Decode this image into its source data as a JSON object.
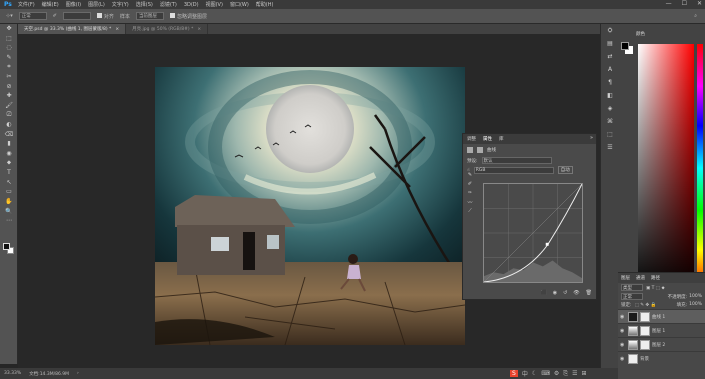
{
  "app": {
    "logo": "Ps"
  },
  "menubar": {
    "items": [
      "文件(F)",
      "编辑(E)",
      "图像(I)",
      "图层(L)",
      "文字(Y)",
      "选择(S)",
      "滤镜(T)",
      "3D(D)",
      "视图(V)",
      "窗口(W)",
      "帮助(H)"
    ],
    "window_controls": [
      "—",
      "☐",
      "✕"
    ]
  },
  "options_bar": {
    "mode": "正常",
    "checkbox_label": "对齐",
    "sample_label": "样本",
    "sample_value": "当前图层",
    "ignore_label": "忽略调整图层"
  },
  "tabs": [
    {
      "label": "天空.psd @ 33.3% (曲线 1, 图层蒙版/8) *",
      "active": true
    },
    {
      "label": "月亮.jpg @ 50% (RGB/8#) *",
      "active": false
    }
  ],
  "tools": [
    "✥",
    "⬚",
    "◌",
    "✎",
    "⌗",
    "✂",
    "⊘",
    "✚",
    "🖌",
    "⎚",
    "◐",
    "⌫",
    "▮",
    "◉",
    "⬥",
    "T",
    "↖",
    "▭",
    "✋",
    "🔍",
    "⋯"
  ],
  "status": {
    "zoom": "33.33%",
    "doc": "文档:14.3M/86.9M",
    "arrow": "›"
  },
  "taskbar": [
    "S",
    "中",
    "☾",
    "⌨",
    "⚙",
    "⎘",
    "☰",
    "⊞"
  ],
  "right_strip": [
    "⛭",
    "▤",
    "⇄",
    "A",
    "¶",
    "◧",
    "◈",
    "⌘",
    "⬚",
    "☰"
  ],
  "color_panel": {
    "tab": "颜色"
  },
  "layers_panel": {
    "tabs": [
      "图层",
      "通道",
      "路径"
    ],
    "kind_label": "类型",
    "blend": "正常",
    "opacity_label": "不透明度:",
    "opacity": "100%",
    "lock_label": "锁定:",
    "fill_label": "填充:",
    "fill": "100%",
    "layers": [
      {
        "name": "曲线 1",
        "selected": true
      },
      {
        "name": "图层 1",
        "selected": false
      },
      {
        "name": "图层 2",
        "selected": false
      },
      {
        "name": "背景",
        "selected": false
      }
    ]
  },
  "properties_panel": {
    "tabs": [
      "调整",
      "属性",
      "库"
    ],
    "active_tab": "属性",
    "close": "»",
    "header": "曲线",
    "preset_label": "预设:",
    "preset_value": "默认",
    "channel_value": "RGB",
    "auto_label": "自动",
    "curve_tools": [
      "⊕",
      "✎",
      "✐",
      "✑",
      "✒",
      "〰",
      "⟋"
    ],
    "footer_icons": [
      "⬛",
      "◉",
      "↺",
      "👁",
      "🗑"
    ]
  }
}
